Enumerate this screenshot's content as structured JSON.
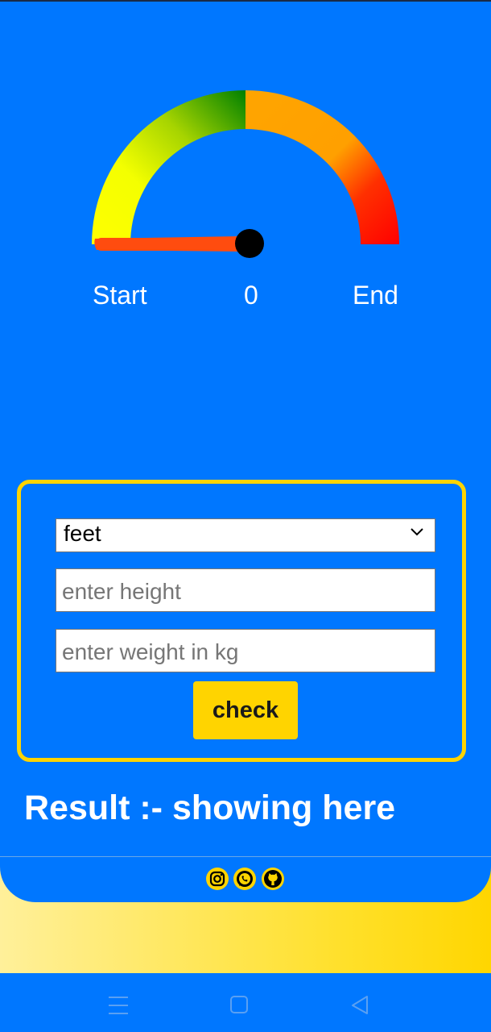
{
  "gauge": {
    "start_label": "Start",
    "value_label": "0",
    "end_label": "End",
    "needle_value": 0,
    "colors": {
      "yellow": "#ffff00",
      "green": "#008000",
      "orange": "#ffa500",
      "red": "#ff0000",
      "needle": "#ff4c0f",
      "hub": "#000000"
    }
  },
  "form": {
    "unit_select": {
      "selected": "feet"
    },
    "height_field": {
      "placeholder": "enter height"
    },
    "weight_field": {
      "placeholder": "enter weight in kg"
    },
    "check_label": "check"
  },
  "result": {
    "text": "Result :- showing here"
  },
  "footer": {
    "icons": [
      "instagram-icon",
      "whatsapp-icon",
      "github-icon"
    ]
  },
  "navbar": {
    "icons": [
      "menu-icon",
      "home-icon",
      "back-icon"
    ]
  },
  "colors": {
    "background": "#0077ff",
    "accent": "#ffd400"
  }
}
